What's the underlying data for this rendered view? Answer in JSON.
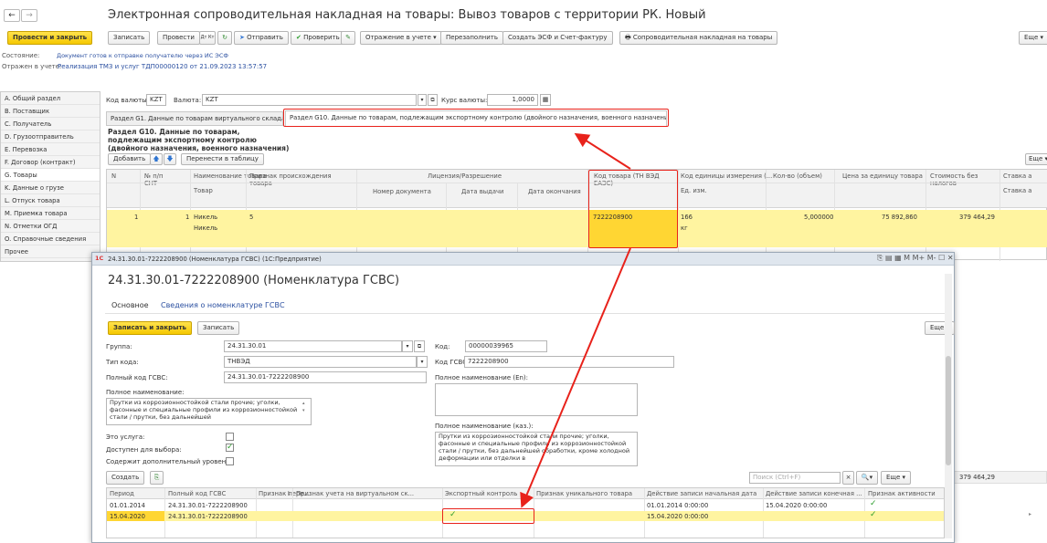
{
  "window": {
    "title": "Электронная сопроводительная накладная на товары: Вывоз товаров с территории РК. Новый",
    "back": "←",
    "forward": "→"
  },
  "toolbar": {
    "post_close": "Провести и закрыть",
    "save": "Записать",
    "post": "Провести",
    "dt_kt": "Дт Кт",
    "send": "Отправить",
    "check": "Проверить",
    "reflection": "Отражение в учете",
    "refill": "Перезаполнить",
    "create_esf": "Создать ЭСФ и Счет-фактуру",
    "print": "Сопроводительная накладная на товары",
    "more": "Еще"
  },
  "status": {
    "label": "Состояние:",
    "value": "Документ готов к отправке получателю через ИС ЭСФ",
    "reflected_label": "Отражен в учете:",
    "reflected_value": "Реализация ТМЗ и услуг ТДП00000120 от 21.09.2023 13:57:57"
  },
  "sidebar": {
    "items": [
      {
        "label": "A. Общий раздел"
      },
      {
        "label": "B. Поставщик"
      },
      {
        "label": "C. Получатель"
      },
      {
        "label": "D. Грузоотправитель"
      },
      {
        "label": "E. Перевозка"
      },
      {
        "label": "F. Договор (контракт)"
      },
      {
        "label": "G. Товары"
      },
      {
        "label": "K. Данные о грузе"
      },
      {
        "label": "L. Отпуск товара"
      },
      {
        "label": "M. Приемка товара"
      },
      {
        "label": "N. Отметки ОГД"
      },
      {
        "label": "O. Справочные сведения"
      },
      {
        "label": "Прочее"
      }
    ]
  },
  "currency": {
    "code_label": "Код валюты:",
    "code_value": "KZT",
    "currency_label": "Валюта:",
    "currency_value": "KZT",
    "rate_label": "Курс валюты:",
    "rate_value": "1,0000"
  },
  "tabs": [
    {
      "label": "Раздел G1. Данные по товарам виртуального склада"
    },
    {
      "label": "Раздел G10. Данные по товарам, подлежащим экспортному контролю (двойного назначения, военного назначения)"
    }
  ],
  "section": {
    "title": "Раздел G10. Данные по товарам, подлежащим экспортному контролю (двойного назначения, военного назначения)",
    "add": "Добавить",
    "transfer": "Перенести в таблицу",
    "more": "Еще"
  },
  "table": {
    "headers": {
      "n": "N",
      "nsnt": "№ п/п СНТ",
      "name": "Наименование товара",
      "name_sub": "Товар",
      "origin": "Признак происхождения товара",
      "license": "Лицензия/Разрешение",
      "doc_num": "Номер документа",
      "issue": "Дата выдачи",
      "expiry": "Дата окончания",
      "code": "Код товара (ТН ВЭД ЕАЭС)",
      "unit": "Код единицы измерения (...",
      "unit_sub": "Ед. изм.",
      "qty": "Кол-во (объем)",
      "price": "Цена за единицу товара",
      "cost": "Стоимость без налогов",
      "rate": "Ставка а"
    },
    "row": {
      "n": "1",
      "nsnt": "1",
      "name": "Никель",
      "name_sub": "Никель",
      "origin": "5",
      "code": "7222208900",
      "unit": "166",
      "unit_sub": "кг",
      "qty": "5,000000",
      "price": "75 892,860",
      "cost": "379 464,29"
    },
    "total": "379 464,29"
  },
  "dialog": {
    "wintitle": "24.31.30.01-7222208900 (Номенклатура ГСВС) (1С:Предприятие)",
    "wincontrols": "M M+ M-",
    "title": "24.31.30.01-7222208900 (Номенклатура ГСВС)",
    "tabs": [
      {
        "label": "Основное"
      },
      {
        "label": "Сведения о номенклатуре ГСВС"
      }
    ],
    "save_close": "Записать и закрыть",
    "save": "Записать",
    "more": "Еще",
    "group_label": "Группа:",
    "group_value": "24.31.30.01",
    "code_label": "Код:",
    "code_value": "00000039965",
    "type_label": "Тип кода:",
    "type_value": "ТНВЭД",
    "gsvs_code_label": "Код ГСВС:",
    "gsvs_code_value": "7222208900",
    "full_code_label": "Полный код ГСВС:",
    "full_code_value": "24.31.30.01-7222208900",
    "full_name_en_label": "Полное наименование (En):",
    "full_name_label": "Полное наименование:",
    "full_name_value": "Прутки из коррозионностойкой стали прочие; уголки, фасонные и специальные профили из коррозионностойкой стали / прутки, без дальнейшей",
    "full_name_kaz_label": "Полное наименование (каз.):",
    "full_name_kaz_value": "Прутки из коррозионностойкой стали прочие; уголки, фасонные и специальные профили из коррозионностойкой стали / прутки, без дальнейшей обработки, кроме холодной деформации или отделки в",
    "service_label": "Это услуга:",
    "available_label": "Доступен для выбора:",
    "contains_label": "Содержит дополнительный уровень:",
    "create": "Создать",
    "search_placeholder": "Поиск (Ctrl+F)",
    "more2": "Еще",
    "grid_headers": {
      "period": "Период",
      "full_code": "Полный код ГСВС",
      "sign_re": "Признак пере...",
      "sign_virtual": "Признак учета на виртуальном ск...",
      "export": "Экспортный контроль",
      "unique": "Признак уникального товара",
      "start": "Действие записи начальная дата",
      "end": "Действие записи конечная ...",
      "active": "Признак активности"
    },
    "rows": [
      {
        "period": "01.01.2014",
        "full_code": "24.31.30.01-7222208900",
        "start": "01.01.2014 0:00:00",
        "end": "15.04.2020 0:00:00"
      },
      {
        "period": "15.04.2020",
        "full_code": "24.31.30.01-7222208900",
        "start": "15.04.2020 0:00:00",
        "end": ""
      }
    ]
  },
  "accent": {
    "yellow": "#f5c800",
    "row_highlight": "#fff4a0",
    "red": "#e8221b",
    "link": "#2a4fa0"
  }
}
